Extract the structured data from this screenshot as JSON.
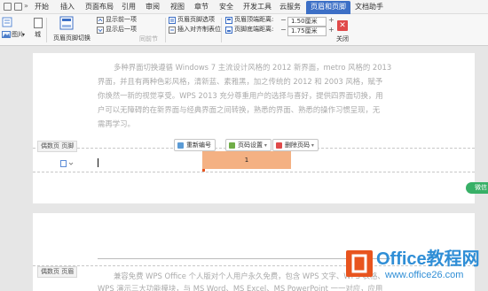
{
  "menu": {
    "items": [
      "开始",
      "插入",
      "页面布局",
      "引用",
      "审阅",
      "视图",
      "章节",
      "安全",
      "开发工具",
      "云服务",
      "页眉和页脚",
      "文档助手"
    ]
  },
  "ribbon": {
    "pic_label": "图片",
    "pic_suffix": "城",
    "switch_label": "页眉页脚切换",
    "show_prev": "显示前一项",
    "show_next": "显示后一项",
    "same_prev": "同前节",
    "options": "页眉页脚选项",
    "insert_align": "插入对齐制表位",
    "header_top_label": "页眉顶端距离:",
    "header_top_value": "1.50厘米",
    "footer_bottom_label": "页脚底端距离:",
    "footer_bottom_value": "1.75厘米",
    "minus": "−",
    "plus": "+",
    "close_label": "关闭",
    "close_x": "✕"
  },
  "doc": {
    "para1_line1": "多种界面切换遵循 Windows 7 主流设计风格的 2012 新界面，metro 风格的 2013",
    "para1_line2": "界面，并且有两种色彩风格，清新蓝、素雅黑，加之传统的 2012 和 2003 风格，赋予",
    "para1_line3": "你焕然一新的视觉享受。WPS 2013 充分尊重用户的选择与喜好，提供四界面切换，用",
    "para1_line4": "户可以无障碍的在新界面与经典界面之间转换，熟悉的界面、熟悉的操作习惯呈现，无",
    "para1_line5": "需再学习。",
    "footer_tag": "偶数页 页脚",
    "header_tag": "偶数页 页眉",
    "btn_renumber": "重新编号",
    "btn_page_settings": "页码设置",
    "btn_delete": "删除页码",
    "page_number": "1",
    "para2_line1": "兼容免费 WPS Office 个人版对个人用户永久免费，包含 WPS 文字、WPS 表格、",
    "para2_line2": "WPS 演示三大功能模块，与 MS Word、MS Excel、MS PowerPoint 一一对应，应用"
  },
  "side_chip": "微信",
  "logo": {
    "brand": "Office教程网",
    "url": "www.office26.com"
  },
  "colors": {
    "accent": "#3c6fc6",
    "highlight": "#f4b183",
    "logo_orange": "#e8541e",
    "logo_blue": "#2f8ed6",
    "close_red": "#e04a4a"
  }
}
